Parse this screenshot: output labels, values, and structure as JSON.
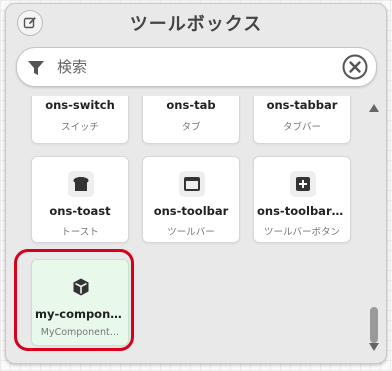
{
  "header": {
    "title": "ツールボックス",
    "edit_icon": "edit-icon"
  },
  "search": {
    "placeholder": "検索",
    "value": "",
    "filter_icon": "filter-icon",
    "clear_icon": "clear-icon"
  },
  "components": [
    {
      "name": "ons-switch",
      "sub": "スイッチ",
      "icon": "none"
    },
    {
      "name": "ons-tab",
      "sub": "タブ",
      "icon": "none"
    },
    {
      "name": "ons-tabbar",
      "sub": "タブバー",
      "icon": "none"
    },
    {
      "name": "ons-toast",
      "sub": "トースト",
      "icon": "toast-icon"
    },
    {
      "name": "ons-toolbar",
      "sub": "ツールバー",
      "icon": "toolbar-icon"
    },
    {
      "name": "ons-toolbar-…",
      "sub": "ツールバーボタン",
      "icon": "plus-square-icon"
    },
    {
      "name": "my-compone…",
      "sub": "MyComponent…",
      "icon": "cube-icon"
    }
  ],
  "colors": {
    "highlight": "#d6001c",
    "custom_card_bg": "#e8f9ec"
  }
}
